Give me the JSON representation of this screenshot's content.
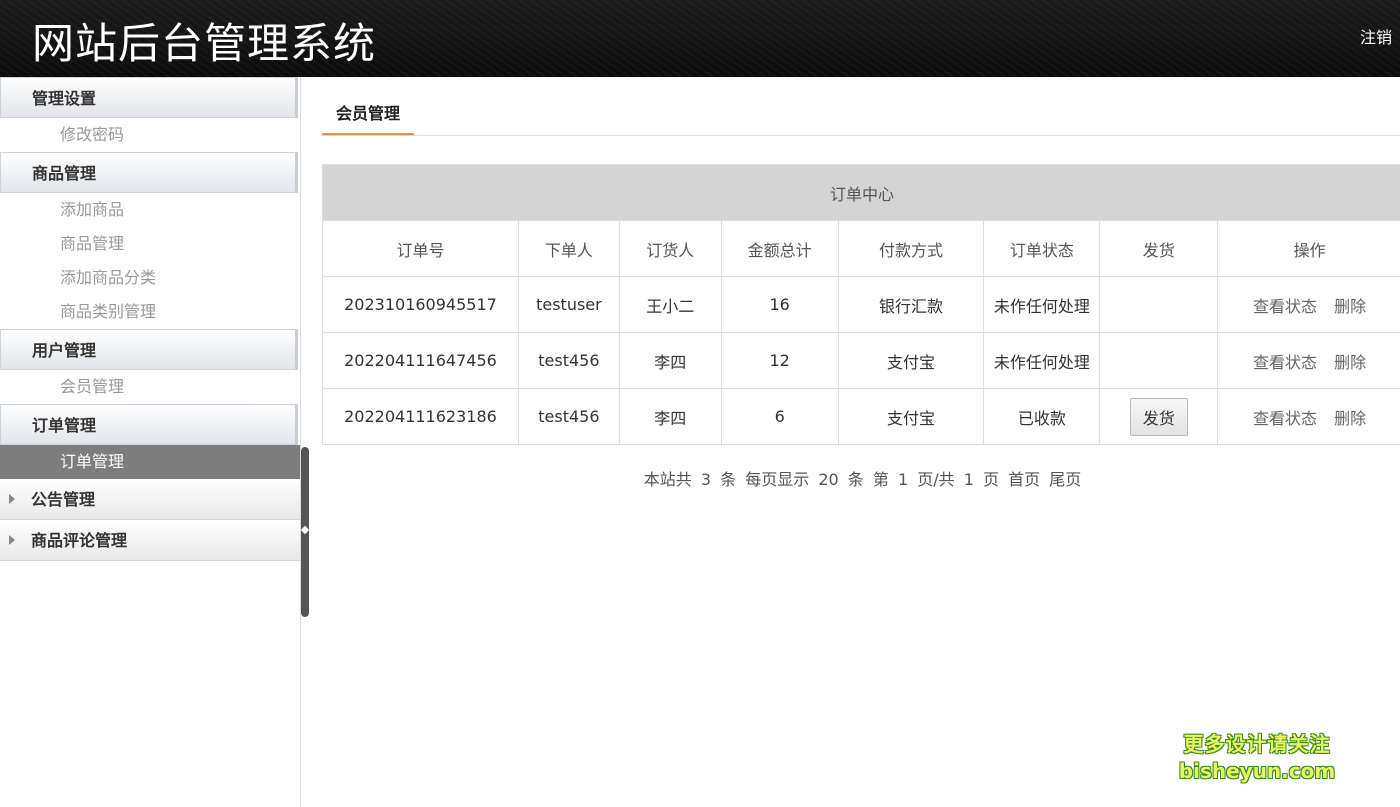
{
  "header": {
    "title": "网站后台管理系统",
    "logout": "注销"
  },
  "sidebar": {
    "groups": [
      {
        "label": "管理设置",
        "items": [
          "修改密码"
        ]
      },
      {
        "label": "商品管理",
        "items": [
          "添加商品",
          "商品管理",
          "添加商品分类",
          "商品类别管理"
        ]
      },
      {
        "label": "用户管理",
        "items": [
          "会员管理"
        ]
      },
      {
        "label": "订单管理",
        "items": [
          "订单管理"
        ]
      },
      {
        "label": "公告管理",
        "items": []
      },
      {
        "label": "商品评论管理",
        "items": []
      }
    ]
  },
  "tab": {
    "label": "会员管理"
  },
  "table": {
    "caption": "订单中心",
    "headers": [
      "订单号",
      "下单人",
      "订货人",
      "金额总计",
      "付款方式",
      "订单状态",
      "发货",
      "操作"
    ],
    "rows": [
      {
        "order_no": "202310160945517",
        "buyer": "testuser",
        "consignee": "王小二",
        "amount": "16",
        "payment": "银行汇款",
        "status": "未作任何处理",
        "ship": "",
        "view": "查看状态",
        "delete": "删除"
      },
      {
        "order_no": "202204111647456",
        "buyer": "test456",
        "consignee": "李四",
        "amount": "12",
        "payment": "支付宝",
        "status": "未作任何处理",
        "ship": "",
        "view": "查看状态",
        "delete": "删除"
      },
      {
        "order_no": "202204111623186",
        "buyer": "test456",
        "consignee": "李四",
        "amount": "6",
        "payment": "支付宝",
        "status": "已收款",
        "ship": "发货",
        "view": "查看状态",
        "delete": "删除"
      }
    ]
  },
  "pager": {
    "total_prefix": "本站共",
    "total": "3",
    "total_unit": "条",
    "per_page_prefix": "每页显示",
    "per_page": "20",
    "per_page_unit": "条",
    "page_prefix": "第",
    "page": "1",
    "page_sep": "页/共",
    "pages": "1",
    "pages_unit": "页",
    "first": "首页",
    "last": "尾页"
  },
  "watermark": {
    "line1": "更多设计请关注",
    "line2": "bisheyun.com"
  }
}
